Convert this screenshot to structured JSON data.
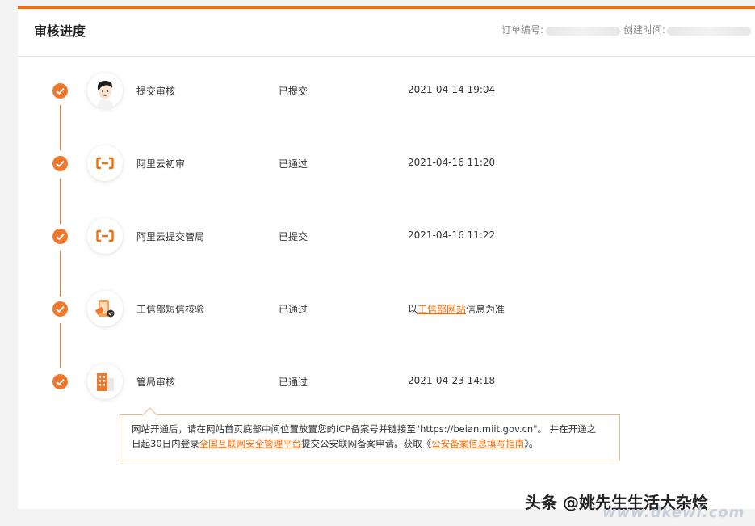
{
  "header": {
    "title": "审核进度",
    "order_label": "订单编号:",
    "created_label": "创建时间:"
  },
  "steps": [
    {
      "name": "提交审核",
      "status": "已提交",
      "time": "2021-04-14 19:04",
      "icon": "user-avatar-icon"
    },
    {
      "name": "阿里云初审",
      "status": "已通过",
      "time": "2021-04-16 11:20",
      "icon": "aliyun-logo-icon"
    },
    {
      "name": "阿里云提交管局",
      "status": "已提交",
      "time": "2021-04-16 11:22",
      "icon": "aliyun-logo-icon"
    },
    {
      "name": "工信部短信核验",
      "status": "已通过",
      "time_prefix": "以",
      "time_link": "工信部网站",
      "time_suffix": "信息为准",
      "icon": "phone-verify-icon"
    },
    {
      "name": "管局审核",
      "status": "已通过",
      "time": "2021-04-23 14:18",
      "icon": "building-icon"
    }
  ],
  "notice": {
    "line1": "网站开通后，请在网站首页底部中间位置放置您的ICP备案号并链接至\"https://beian.miit.gov.cn\"。 并在开通之",
    "line2_a": "日起30日内登录",
    "link1": "全国互联网安全管理平台",
    "line2_b": "提交公安联网备案申请。获取《",
    "link2": "公安备案信息填写指南",
    "line2_c": "》。"
  },
  "watermark": {
    "text": "头条 @姚先生生活大杂烩",
    "site": "www.dkewl.com"
  },
  "colors": {
    "accent": "#ff6a00",
    "check": "#f0782a"
  }
}
